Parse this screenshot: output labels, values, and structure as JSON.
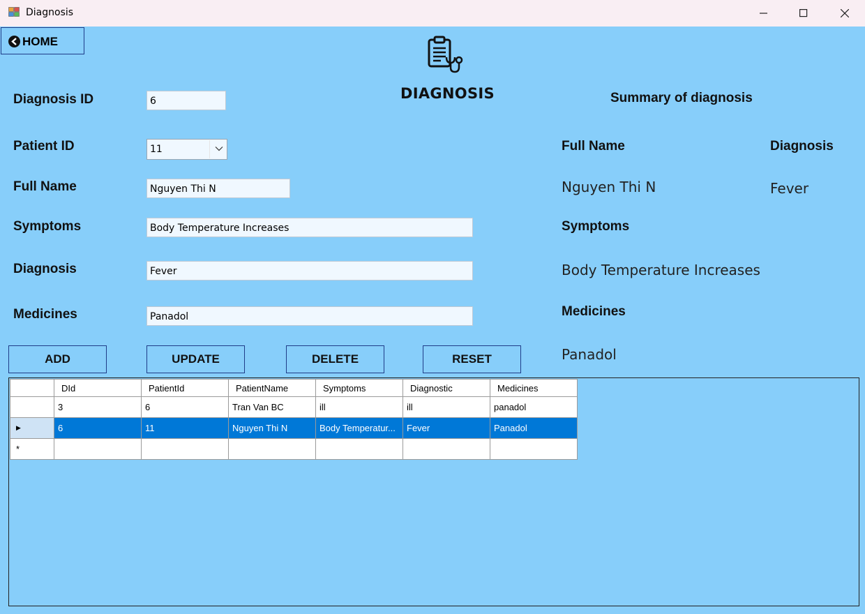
{
  "window": {
    "title": "Diagnosis"
  },
  "header": {
    "home_label": "HOME",
    "title": "DIAGNOSIS"
  },
  "form": {
    "diagnosis_id_label": "Diagnosis ID",
    "diagnosis_id_value": "6",
    "patient_id_label": "Patient ID",
    "patient_id_value": "11",
    "full_name_label": "Full Name",
    "full_name_value": "Nguyen Thi N",
    "symptoms_label": "Symptoms",
    "symptoms_value": "Body Temperature Increases",
    "diagnosis_label": "Diagnosis",
    "diagnosis_value": "Fever",
    "medicines_label": "Medicines",
    "medicines_value": "Panadol"
  },
  "buttons": {
    "add": "ADD",
    "update": "UPDATE",
    "delete": "DELETE",
    "reset": "RESET"
  },
  "summary": {
    "title": "Summary of diagnosis",
    "full_name_label": "Full Name",
    "full_name_value": "Nguyen Thi N",
    "diagnosis_label": "Diagnosis",
    "diagnosis_value": "Fever",
    "symptoms_label": "Symptoms",
    "symptoms_value": "Body Temperature Increases",
    "medicines_label": "Medicines",
    "medicines_value": "Panadol"
  },
  "grid": {
    "columns": [
      "DId",
      "PatientId",
      "PatientName",
      "Symptoms",
      "Diagnostic",
      "Medicines"
    ],
    "rows": [
      [
        "3",
        "6",
        "Tran Van BC",
        "ill",
        "ill",
        "panadol"
      ],
      [
        "6",
        "11",
        "Nguyen Thi N",
        "Body Temperatur...",
        "Fever",
        "Panadol"
      ]
    ],
    "row_markers": [
      "",
      "▶",
      "*"
    ]
  },
  "colors": {
    "background": "#87CEFA",
    "selected_row": "#0078D7",
    "input_bg": "#F0F8FF"
  },
  "icons": [
    "app-icon",
    "minimize-icon",
    "maximize-icon",
    "close-icon",
    "back-arrow-icon",
    "clipboard-stethoscope-icon",
    "chevron-down-icon"
  ]
}
